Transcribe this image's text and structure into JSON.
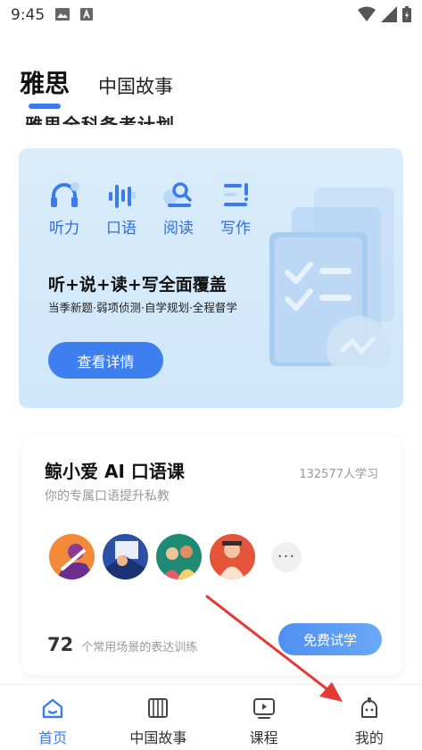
{
  "status_bar": {
    "time": "9:45"
  },
  "tabs": [
    {
      "label": "雅思",
      "active": true
    },
    {
      "label": "中国故事",
      "active": false
    }
  ],
  "partial_title": "雅思全科备考计划",
  "promo": {
    "skills": [
      {
        "label": "听力",
        "icon": "headphones-icon"
      },
      {
        "label": "口语",
        "icon": "microphone-icon"
      },
      {
        "label": "阅读",
        "icon": "magnifier-icon"
      },
      {
        "label": "写作",
        "icon": "pen-icon"
      }
    ],
    "headline": "听+说+读+写全面覆盖",
    "subline": "当季新题·弱项侦测·自学规划·全程督学",
    "button": "查看详情"
  },
  "course": {
    "title": "鲸小爱 AI 口语课",
    "learners": "132577人学习",
    "description": "你的专属口语提升私教",
    "more": "···",
    "count": "72",
    "count_text": "个常用场景的表达训练",
    "button": "免费试学"
  },
  "nav": [
    {
      "label": "首页",
      "icon": "home-icon",
      "active": true
    },
    {
      "label": "中国故事",
      "icon": "book-icon",
      "active": false
    },
    {
      "label": "课程",
      "icon": "play-icon",
      "active": false
    },
    {
      "label": "我的",
      "icon": "profile-icon",
      "active": false
    }
  ],
  "colors": {
    "accent": "#3a7cf0",
    "card_bg": "#d9ecfb",
    "annotation": "#e53935"
  }
}
